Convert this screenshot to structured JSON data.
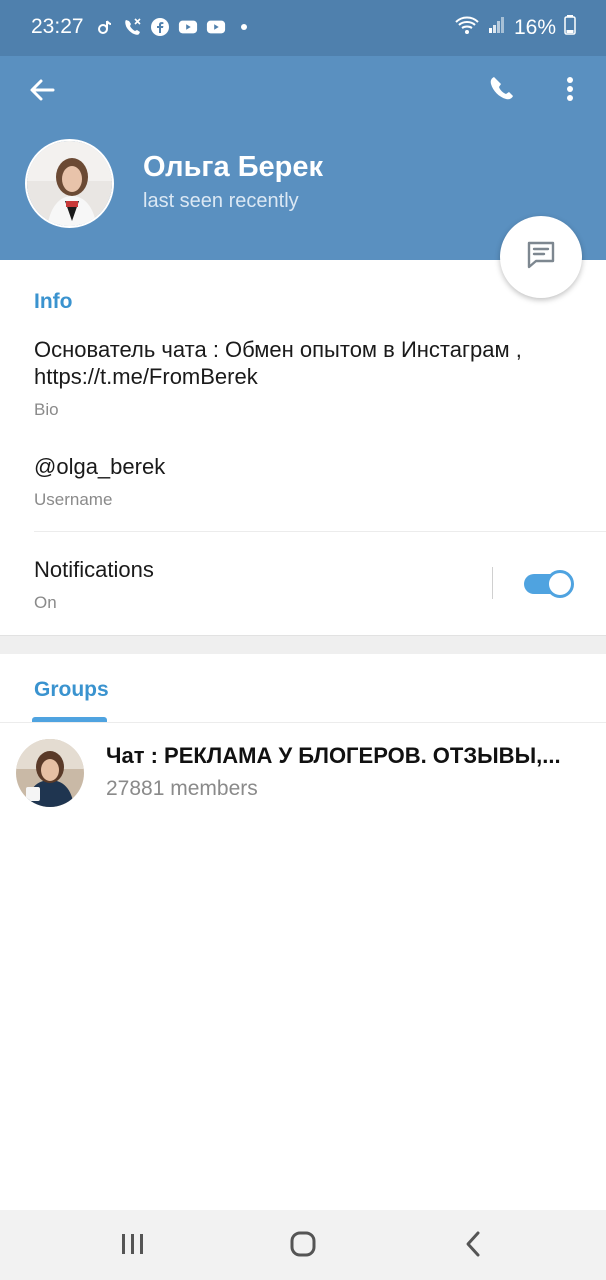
{
  "status_bar": {
    "time": "23:27",
    "battery": "16%",
    "left_icons": [
      "tiktok-icon",
      "missed-call-icon",
      "facebook-icon",
      "youtube-icon",
      "youtube-icon",
      "dot-icon"
    ],
    "right_icons": [
      "wifi-icon",
      "signal-icon",
      "battery-icon"
    ]
  },
  "header": {
    "name": "Ольга Берек",
    "status": "last seen recently",
    "actions": [
      "back-icon",
      "phone-icon",
      "more-vert-icon"
    ],
    "fab_icon": "message-icon"
  },
  "info": {
    "title": "Info",
    "bio_value": "Основатель чата : Обмен опытом в Инстаграм , https://t.me/FromBerek",
    "bio_caption": "Bio",
    "username_value": "@olga_berek",
    "username_caption": "Username",
    "notifications_label": "Notifications",
    "notifications_state": "On",
    "notifications_enabled": true
  },
  "groups": {
    "tab_label": "Groups",
    "items": [
      {
        "title": "Чат : РЕКЛАМА У БЛОГЕРОВ. ОТЗЫВЫ,...",
        "members": "27881 members"
      }
    ]
  },
  "nav": [
    "recents-icon",
    "home-icon",
    "back-nav-icon"
  ],
  "colors": {
    "header": "#5a90c0",
    "status_bar": "#4f80ad",
    "accent": "#3a93cf",
    "toggle": "#4fa3e0"
  }
}
